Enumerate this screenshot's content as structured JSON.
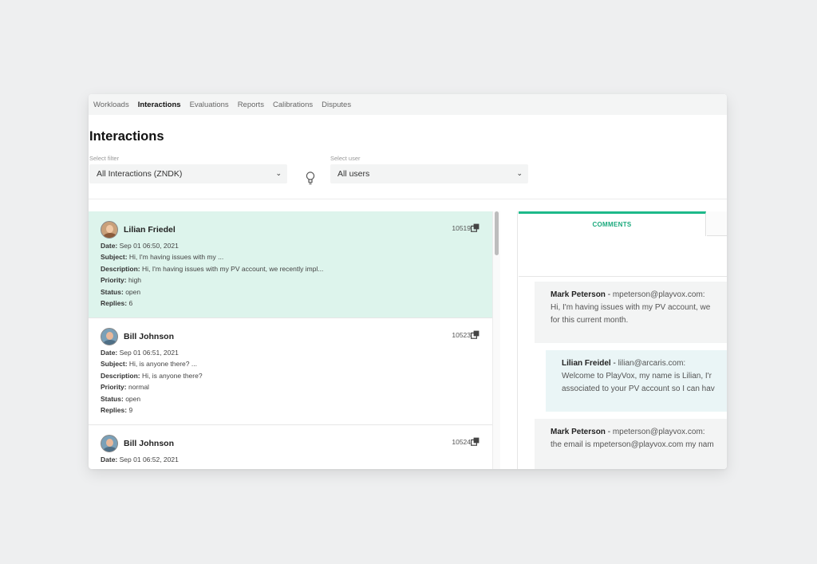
{
  "nav": {
    "items": [
      "Workloads",
      "Interactions",
      "Evaluations",
      "Reports",
      "Calibrations",
      "Disputes"
    ],
    "active": "Interactions"
  },
  "page": {
    "title": "Interactions"
  },
  "filters": {
    "filter_label": "Select filter",
    "filter_value": "All Interactions (ZNDK)",
    "user_label": "Select user",
    "user_value": "All users"
  },
  "labels": {
    "date": "Date:",
    "subject": "Subject:",
    "description": "Description:",
    "priority": "Priority:",
    "status": "Status:",
    "replies": "Replies:"
  },
  "interactions": [
    {
      "name": "Lilian Friedel",
      "id": "10519",
      "date": "Sep 01 06:50, 2021",
      "subject": "Hi, I'm having issues with my ...",
      "description": "Hi, I'm having issues with my PV account, we recently impl...",
      "priority": "high",
      "status": "open",
      "replies": "6",
      "selected": true
    },
    {
      "name": "Bill Johnson",
      "id": "10523",
      "date": "Sep 01 06:51, 2021",
      "subject": "Hi, is anyone there? ...",
      "description": "Hi, is anyone there?",
      "priority": "normal",
      "status": "open",
      "replies": "9",
      "selected": false
    },
    {
      "name": "Bill Johnson",
      "id": "10524",
      "date": "Sep 01 06:52, 2021",
      "selected": false
    }
  ],
  "detail": {
    "tab_comments": "COMMENTS",
    "comments": [
      {
        "author": "Mark Peterson",
        "separator": " - ",
        "email": "mpeterson@playvox.com:",
        "lines": [
          "Hi, I'm having issues with my PV account, we",
          "for this current month."
        ]
      },
      {
        "author": "Lilian Freidel",
        "separator": " - ",
        "email": "lilian@arcaris.com:",
        "lines": [
          "Welcome to PlayVox, my name is Lilian, I'r",
          "associated to your PV account so I can hav"
        ]
      },
      {
        "author": "Mark Peterson",
        "separator": " - ",
        "email": "mpeterson@playvox.com:",
        "lines": [
          "the email is mpeterson@playvox.com my nam"
        ]
      }
    ]
  },
  "colors": {
    "accent": "#1db98a",
    "selected_row": "#ddf4ec",
    "reply_bg": "#eaf5f6",
    "comment_bg": "#f3f4f4"
  }
}
